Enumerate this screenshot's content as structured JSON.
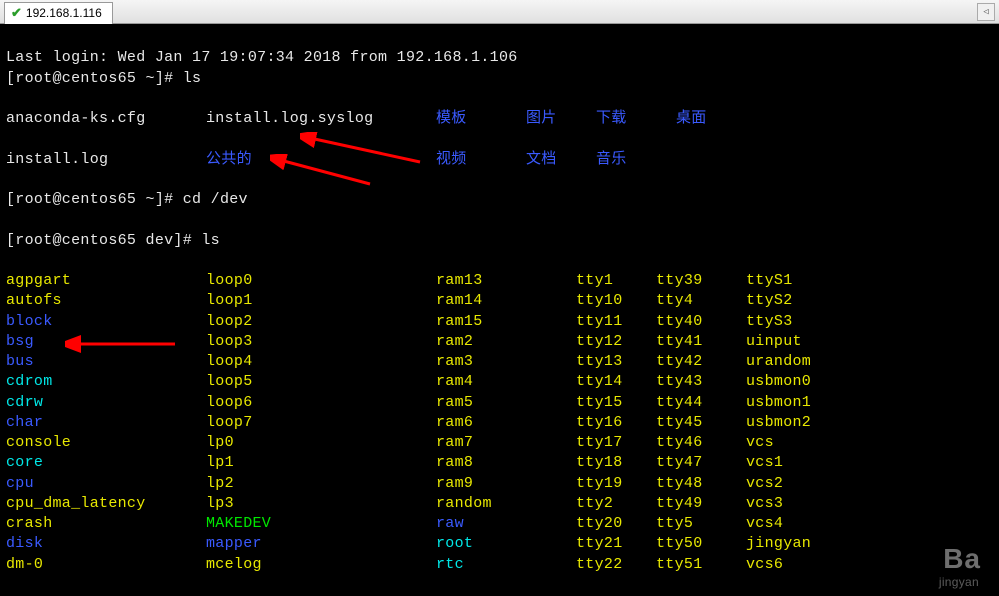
{
  "titlebar": {
    "tab_label": "192.168.1.116"
  },
  "login_line": "Last login: Wed Jan 17 19:07:34 2018 from 192.168.1.106",
  "prompt1": "[root@centos65 ~]# ",
  "cmd1": "ls",
  "ls1": {
    "row1": {
      "a": "anaconda-ks.cfg",
      "b": "install.log.syslog",
      "c": "模板",
      "d": "图片",
      "e": "下载",
      "f": "桌面"
    },
    "row2": {
      "a": "install.log",
      "b": "公共的",
      "c": "视频",
      "d": "文档",
      "e": "音乐"
    }
  },
  "prompt2": "[root@centos65 ~]# ",
  "cmd2": "cd /dev",
  "prompt3": "[root@centos65 dev]# ",
  "cmd3": "ls",
  "dev_rows": [
    {
      "a": "agpgart",
      "ac": "yellow",
      "b": "loop0",
      "bc": "yellow",
      "c": "ram13",
      "cc": "yellow",
      "d": "tty1",
      "dc": "yellow",
      "e": "tty39",
      "ec": "yellow",
      "f": "ttyS1",
      "fc": "yellow"
    },
    {
      "a": "autofs",
      "ac": "yellow",
      "b": "loop1",
      "bc": "yellow",
      "c": "ram14",
      "cc": "yellow",
      "d": "tty10",
      "dc": "yellow",
      "e": "tty4",
      "ec": "yellow",
      "f": "ttyS2",
      "fc": "yellow"
    },
    {
      "a": "block",
      "ac": "blue",
      "b": "loop2",
      "bc": "yellow",
      "c": "ram15",
      "cc": "yellow",
      "d": "tty11",
      "dc": "yellow",
      "e": "tty40",
      "ec": "yellow",
      "f": "ttyS3",
      "fc": "yellow"
    },
    {
      "a": "bsg",
      "ac": "blue",
      "b": "loop3",
      "bc": "yellow",
      "c": "ram2",
      "cc": "yellow",
      "d": "tty12",
      "dc": "yellow",
      "e": "tty41",
      "ec": "yellow",
      "f": "uinput",
      "fc": "yellow"
    },
    {
      "a": "bus",
      "ac": "blue",
      "b": "loop4",
      "bc": "yellow",
      "c": "ram3",
      "cc": "yellow",
      "d": "tty13",
      "dc": "yellow",
      "e": "tty42",
      "ec": "yellow",
      "f": "urandom",
      "fc": "yellow"
    },
    {
      "a": "cdrom",
      "ac": "cyan",
      "b": "loop5",
      "bc": "yellow",
      "c": "ram4",
      "cc": "yellow",
      "d": "tty14",
      "dc": "yellow",
      "e": "tty43",
      "ec": "yellow",
      "f": "usbmon0",
      "fc": "yellow"
    },
    {
      "a": "cdrw",
      "ac": "cyan",
      "b": "loop6",
      "bc": "yellow",
      "c": "ram5",
      "cc": "yellow",
      "d": "tty15",
      "dc": "yellow",
      "e": "tty44",
      "ec": "yellow",
      "f": "usbmon1",
      "fc": "yellow"
    },
    {
      "a": "char",
      "ac": "blue",
      "b": "loop7",
      "bc": "yellow",
      "c": "ram6",
      "cc": "yellow",
      "d": "tty16",
      "dc": "yellow",
      "e": "tty45",
      "ec": "yellow",
      "f": "usbmon2",
      "fc": "yellow"
    },
    {
      "a": "console",
      "ac": "yellow",
      "b": "lp0",
      "bc": "yellow",
      "c": "ram7",
      "cc": "yellow",
      "d": "tty17",
      "dc": "yellow",
      "e": "tty46",
      "ec": "yellow",
      "f": "vcs",
      "fc": "yellow"
    },
    {
      "a": "core",
      "ac": "cyan",
      "b": "lp1",
      "bc": "yellow",
      "c": "ram8",
      "cc": "yellow",
      "d": "tty18",
      "dc": "yellow",
      "e": "tty47",
      "ec": "yellow",
      "f": "vcs1",
      "fc": "yellow"
    },
    {
      "a": "cpu",
      "ac": "blue",
      "b": "lp2",
      "bc": "yellow",
      "c": "ram9",
      "cc": "yellow",
      "d": "tty19",
      "dc": "yellow",
      "e": "tty48",
      "ec": "yellow",
      "f": "vcs2",
      "fc": "yellow"
    },
    {
      "a": "cpu_dma_latency",
      "ac": "yellow",
      "b": "lp3",
      "bc": "yellow",
      "c": "random",
      "cc": "yellow",
      "d": "tty2",
      "dc": "yellow",
      "e": "tty49",
      "ec": "yellow",
      "f": "vcs3",
      "fc": "yellow"
    },
    {
      "a": "crash",
      "ac": "yellow",
      "b": "MAKEDEV",
      "bc": "green",
      "c": "raw",
      "cc": "blue",
      "d": "tty20",
      "dc": "yellow",
      "e": "tty5",
      "ec": "yellow",
      "f": "vcs4",
      "fc": "yellow"
    },
    {
      "a": "disk",
      "ac": "blue",
      "b": "mapper",
      "bc": "blue",
      "c": "root",
      "cc": "cyan",
      "d": "tty21",
      "dc": "yellow",
      "e": "tty50",
      "ec": "yellow",
      "f": "jingyan",
      "fc": "yellow"
    },
    {
      "a": "dm-0",
      "ac": "yellow",
      "b": "mcelog",
      "bc": "yellow",
      "c": "rtc",
      "cc": "cyan",
      "d": "tty22",
      "dc": "yellow",
      "e": "tty51",
      "ec": "yellow",
      "f": "vcs6",
      "fc": "yellow"
    }
  ],
  "watermark": "Ba",
  "watermark_sub": "jingyan"
}
